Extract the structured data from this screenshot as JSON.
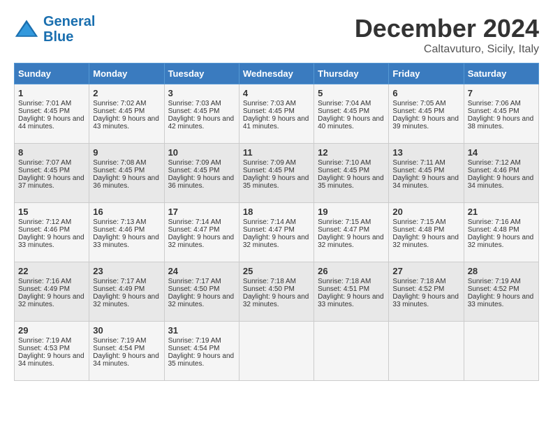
{
  "logo": {
    "line1": "General",
    "line2": "Blue"
  },
  "title": "December 2024",
  "location": "Caltavuturo, Sicily, Italy",
  "days_of_week": [
    "Sunday",
    "Monday",
    "Tuesday",
    "Wednesday",
    "Thursday",
    "Friday",
    "Saturday"
  ],
  "weeks": [
    [
      {
        "day": 1,
        "sunrise": "Sunrise: 7:01 AM",
        "sunset": "Sunset: 4:45 PM",
        "daylight": "Daylight: 9 hours and 44 minutes."
      },
      {
        "day": 2,
        "sunrise": "Sunrise: 7:02 AM",
        "sunset": "Sunset: 4:45 PM",
        "daylight": "Daylight: 9 hours and 43 minutes."
      },
      {
        "day": 3,
        "sunrise": "Sunrise: 7:03 AM",
        "sunset": "Sunset: 4:45 PM",
        "daylight": "Daylight: 9 hours and 42 minutes."
      },
      {
        "day": 4,
        "sunrise": "Sunrise: 7:03 AM",
        "sunset": "Sunset: 4:45 PM",
        "daylight": "Daylight: 9 hours and 41 minutes."
      },
      {
        "day": 5,
        "sunrise": "Sunrise: 7:04 AM",
        "sunset": "Sunset: 4:45 PM",
        "daylight": "Daylight: 9 hours and 40 minutes."
      },
      {
        "day": 6,
        "sunrise": "Sunrise: 7:05 AM",
        "sunset": "Sunset: 4:45 PM",
        "daylight": "Daylight: 9 hours and 39 minutes."
      },
      {
        "day": 7,
        "sunrise": "Sunrise: 7:06 AM",
        "sunset": "Sunset: 4:45 PM",
        "daylight": "Daylight: 9 hours and 38 minutes."
      }
    ],
    [
      {
        "day": 8,
        "sunrise": "Sunrise: 7:07 AM",
        "sunset": "Sunset: 4:45 PM",
        "daylight": "Daylight: 9 hours and 37 minutes."
      },
      {
        "day": 9,
        "sunrise": "Sunrise: 7:08 AM",
        "sunset": "Sunset: 4:45 PM",
        "daylight": "Daylight: 9 hours and 36 minutes."
      },
      {
        "day": 10,
        "sunrise": "Sunrise: 7:09 AM",
        "sunset": "Sunset: 4:45 PM",
        "daylight": "Daylight: 9 hours and 36 minutes."
      },
      {
        "day": 11,
        "sunrise": "Sunrise: 7:09 AM",
        "sunset": "Sunset: 4:45 PM",
        "daylight": "Daylight: 9 hours and 35 minutes."
      },
      {
        "day": 12,
        "sunrise": "Sunrise: 7:10 AM",
        "sunset": "Sunset: 4:45 PM",
        "daylight": "Daylight: 9 hours and 35 minutes."
      },
      {
        "day": 13,
        "sunrise": "Sunrise: 7:11 AM",
        "sunset": "Sunset: 4:45 PM",
        "daylight": "Daylight: 9 hours and 34 minutes."
      },
      {
        "day": 14,
        "sunrise": "Sunrise: 7:12 AM",
        "sunset": "Sunset: 4:46 PM",
        "daylight": "Daylight: 9 hours and 34 minutes."
      }
    ],
    [
      {
        "day": 15,
        "sunrise": "Sunrise: 7:12 AM",
        "sunset": "Sunset: 4:46 PM",
        "daylight": "Daylight: 9 hours and 33 minutes."
      },
      {
        "day": 16,
        "sunrise": "Sunrise: 7:13 AM",
        "sunset": "Sunset: 4:46 PM",
        "daylight": "Daylight: 9 hours and 33 minutes."
      },
      {
        "day": 17,
        "sunrise": "Sunrise: 7:14 AM",
        "sunset": "Sunset: 4:47 PM",
        "daylight": "Daylight: 9 hours and 32 minutes."
      },
      {
        "day": 18,
        "sunrise": "Sunrise: 7:14 AM",
        "sunset": "Sunset: 4:47 PM",
        "daylight": "Daylight: 9 hours and 32 minutes."
      },
      {
        "day": 19,
        "sunrise": "Sunrise: 7:15 AM",
        "sunset": "Sunset: 4:47 PM",
        "daylight": "Daylight: 9 hours and 32 minutes."
      },
      {
        "day": 20,
        "sunrise": "Sunrise: 7:15 AM",
        "sunset": "Sunset: 4:48 PM",
        "daylight": "Daylight: 9 hours and 32 minutes."
      },
      {
        "day": 21,
        "sunrise": "Sunrise: 7:16 AM",
        "sunset": "Sunset: 4:48 PM",
        "daylight": "Daylight: 9 hours and 32 minutes."
      }
    ],
    [
      {
        "day": 22,
        "sunrise": "Sunrise: 7:16 AM",
        "sunset": "Sunset: 4:49 PM",
        "daylight": "Daylight: 9 hours and 32 minutes."
      },
      {
        "day": 23,
        "sunrise": "Sunrise: 7:17 AM",
        "sunset": "Sunset: 4:49 PM",
        "daylight": "Daylight: 9 hours and 32 minutes."
      },
      {
        "day": 24,
        "sunrise": "Sunrise: 7:17 AM",
        "sunset": "Sunset: 4:50 PM",
        "daylight": "Daylight: 9 hours and 32 minutes."
      },
      {
        "day": 25,
        "sunrise": "Sunrise: 7:18 AM",
        "sunset": "Sunset: 4:50 PM",
        "daylight": "Daylight: 9 hours and 32 minutes."
      },
      {
        "day": 26,
        "sunrise": "Sunrise: 7:18 AM",
        "sunset": "Sunset: 4:51 PM",
        "daylight": "Daylight: 9 hours and 33 minutes."
      },
      {
        "day": 27,
        "sunrise": "Sunrise: 7:18 AM",
        "sunset": "Sunset: 4:52 PM",
        "daylight": "Daylight: 9 hours and 33 minutes."
      },
      {
        "day": 28,
        "sunrise": "Sunrise: 7:19 AM",
        "sunset": "Sunset: 4:52 PM",
        "daylight": "Daylight: 9 hours and 33 minutes."
      }
    ],
    [
      {
        "day": 29,
        "sunrise": "Sunrise: 7:19 AM",
        "sunset": "Sunset: 4:53 PM",
        "daylight": "Daylight: 9 hours and 34 minutes."
      },
      {
        "day": 30,
        "sunrise": "Sunrise: 7:19 AM",
        "sunset": "Sunset: 4:54 PM",
        "daylight": "Daylight: 9 hours and 34 minutes."
      },
      {
        "day": 31,
        "sunrise": "Sunrise: 7:19 AM",
        "sunset": "Sunset: 4:54 PM",
        "daylight": "Daylight: 9 hours and 35 minutes."
      },
      null,
      null,
      null,
      null
    ]
  ]
}
